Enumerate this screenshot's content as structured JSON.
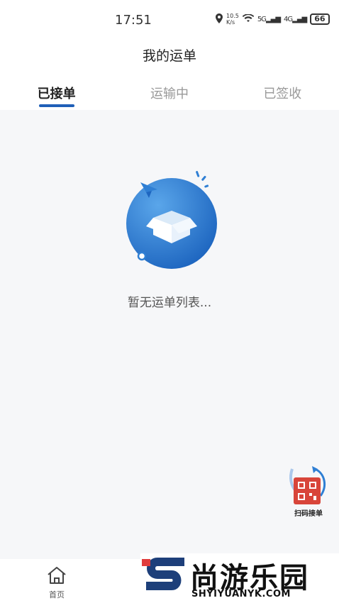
{
  "status_bar": {
    "time": "17:51",
    "net_speed_value": "10.5",
    "net_speed_unit": "K/s",
    "signal_5g": "5G",
    "signal_4g": "4G",
    "battery": "66"
  },
  "header": {
    "title": "我的运单"
  },
  "tabs": [
    {
      "label": "已接单",
      "active": true
    },
    {
      "label": "运输中",
      "active": false
    },
    {
      "label": "已签收",
      "active": false
    }
  ],
  "empty_state": {
    "message": "暂无运单列表..."
  },
  "scan_widget": {
    "label": "扫码接单"
  },
  "bottom_nav": {
    "home_label": "首页"
  },
  "watermark": {
    "title": "尚游乐园",
    "url": "SHYIYUANYK.COM"
  },
  "colors": {
    "accent": "#1f5fb8",
    "illustration_blue": "#2f7fd4",
    "scan_red": "#d8453a"
  }
}
